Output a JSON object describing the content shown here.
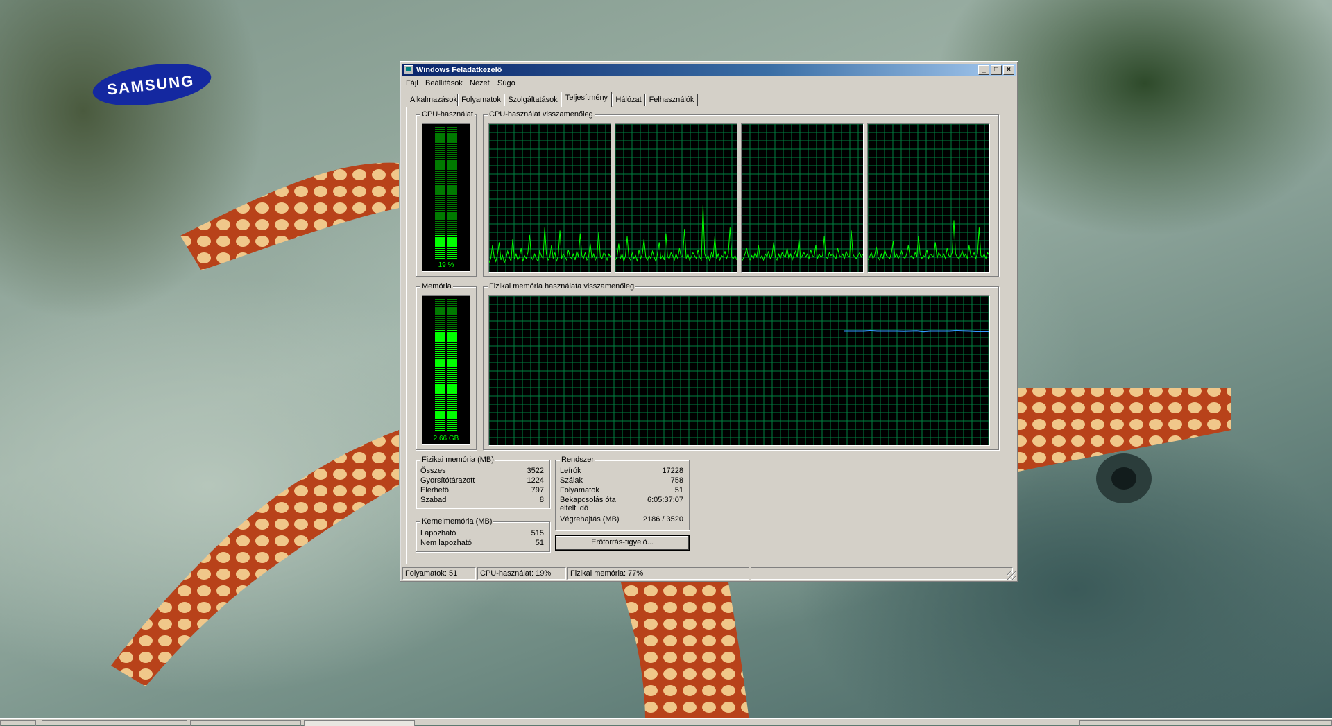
{
  "desktop": {
    "logo_text": "SAMSUNG"
  },
  "window": {
    "title": "Windows Feladatkezelő",
    "controls": {
      "minimize": "_",
      "maximize": "□",
      "close": "×"
    }
  },
  "menu": [
    "Fájl",
    "Beállítások",
    "Nézet",
    "Súgó"
  ],
  "tabs": [
    {
      "label": "Alkalmazások",
      "active": false
    },
    {
      "label": "Folyamatok",
      "active": false
    },
    {
      "label": "Szolgáltatások",
      "active": false
    },
    {
      "label": "Teljesítmény",
      "active": true
    },
    {
      "label": "Hálózat",
      "active": false
    },
    {
      "label": "Felhasználók",
      "active": false
    }
  ],
  "performance": {
    "cpu_usage": {
      "label": "CPU-használat",
      "value": "19 %",
      "fraction": 0.19
    },
    "cpu_history": {
      "label": "CPU-használat visszamenőleg",
      "color": "#00ff00",
      "cores": [
        [
          6,
          9,
          18,
          10,
          7,
          12,
          20,
          8,
          11,
          6,
          9,
          14,
          10,
          7,
          22,
          9,
          12,
          8,
          10,
          16,
          7,
          11,
          9,
          13,
          25,
          10,
          8,
          12,
          9,
          7,
          14,
          11,
          9,
          30,
          12,
          8,
          10,
          18,
          9,
          13,
          7,
          11,
          28,
          9,
          12,
          10,
          8,
          15,
          10,
          9,
          12,
          8,
          14,
          10,
          26,
          11,
          9,
          13,
          8,
          10,
          19,
          9,
          12,
          8,
          11,
          27,
          10,
          9,
          13,
          11,
          8,
          12,
          10
        ],
        [
          8,
          10,
          19,
          9,
          12,
          7,
          11,
          24,
          10,
          8,
          13,
          9,
          11,
          7,
          15,
          9,
          12,
          22,
          10,
          8,
          11,
          9,
          14,
          10,
          7,
          12,
          20,
          9,
          11,
          8,
          26,
          10,
          9,
          13,
          11,
          8,
          12,
          9,
          16,
          10,
          11,
          29,
          9,
          12,
          8,
          10,
          13,
          11,
          9,
          15,
          10,
          8,
          45,
          12,
          9,
          11,
          7,
          13,
          10,
          24,
          9,
          12,
          8,
          11,
          10,
          14,
          9,
          12,
          30,
          10,
          9,
          11,
          8
        ],
        [
          7,
          9,
          12,
          16,
          10,
          8,
          11,
          9,
          13,
          10,
          18,
          9,
          11,
          8,
          12,
          10,
          14,
          9,
          11,
          20,
          10,
          8,
          12,
          9,
          13,
          11,
          10,
          16,
          9,
          12,
          8,
          11,
          14,
          10,
          22,
          9,
          11,
          13,
          10,
          12,
          9,
          15,
          11,
          10,
          18,
          9,
          12,
          10,
          11,
          24,
          10,
          9,
          13,
          11,
          12,
          10,
          9,
          16,
          11,
          10,
          12,
          9,
          14,
          11,
          10,
          28,
          12,
          10,
          9,
          11,
          13,
          10,
          12
        ],
        [
          8,
          10,
          13,
          9,
          11,
          17,
          10,
          8,
          12,
          9,
          15,
          11,
          10,
          9,
          13,
          21,
          10,
          12,
          9,
          11,
          14,
          10,
          9,
          12,
          18,
          10,
          11,
          9,
          13,
          10,
          24,
          12,
          9,
          11,
          10,
          15,
          9,
          12,
          11,
          10,
          20,
          9,
          13,
          11,
          10,
          12,
          9,
          16,
          11,
          10,
          13,
          35,
          12,
          10,
          9,
          11,
          14,
          10,
          12,
          9,
          18,
          11,
          10,
          13,
          9,
          12,
          30,
          11,
          10,
          12,
          9,
          13,
          11
        ]
      ]
    },
    "memory": {
      "label": "Memória",
      "value": "2,66 GB",
      "fraction": 0.77
    },
    "memory_history": {
      "label": "Fizikai memória használata visszamenőleg",
      "color": "#3399ff",
      "series": [
        0.765,
        0.765,
        0.765,
        0.765,
        0.768,
        0.765,
        0.765,
        0.765,
        0.765,
        0.764,
        0.765,
        0.766,
        0.762,
        0.765,
        0.765,
        0.765,
        0.765,
        0.768,
        0.766,
        0.765,
        0.763,
        0.763,
        0.763
      ]
    },
    "physical_memory": {
      "label": "Fizikai memória (MB)",
      "rows": [
        {
          "k": "Összes",
          "v": "3522"
        },
        {
          "k": "Gyorsítótárazott",
          "v": "1224"
        },
        {
          "k": "Elérhető",
          "v": "797"
        },
        {
          "k": "Szabad",
          "v": "8"
        }
      ]
    },
    "kernel_memory": {
      "label": "Kernelmemória (MB)",
      "rows": [
        {
          "k": "Lapozható",
          "v": "515"
        },
        {
          "k": "Nem lapozható",
          "v": "51"
        }
      ]
    },
    "system": {
      "label": "Rendszer",
      "rows": [
        {
          "k": "Leírók",
          "v": "17228"
        },
        {
          "k": "Szálak",
          "v": "758"
        },
        {
          "k": "Folyamatok",
          "v": "51"
        },
        {
          "k": "Bekapcsolás óta",
          "v": "6:05:37:07"
        },
        {
          "k": "eltelt idő",
          "v": ""
        },
        {
          "k": "Végrehajtás (MB)",
          "v": "2186 / 3520"
        }
      ]
    },
    "resource_monitor_button": "Erőforrás-figyelő..."
  },
  "statusbar": {
    "processes": "Folyamatok: 51",
    "cpu": "CPU-használat: 19%",
    "memory": "Fizikai memória: 77%"
  }
}
